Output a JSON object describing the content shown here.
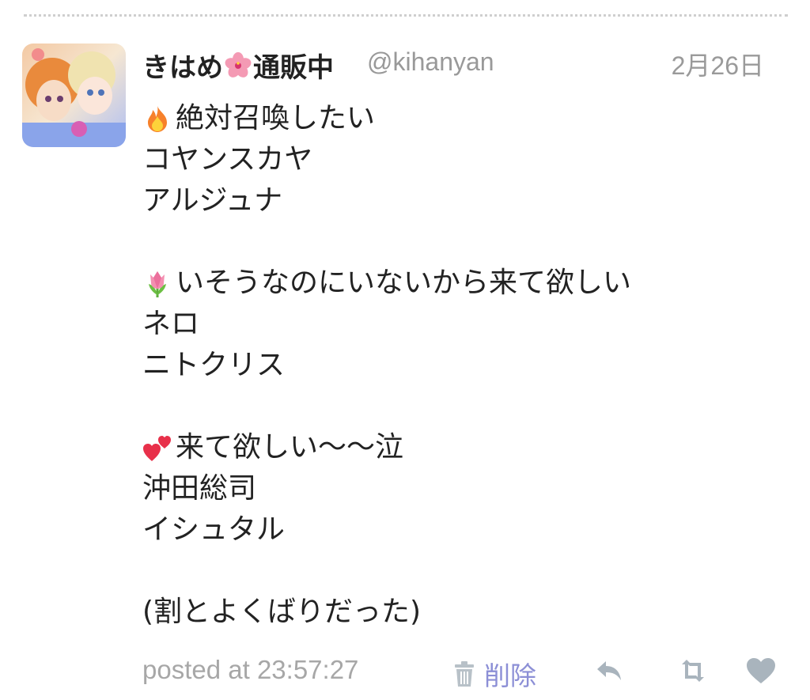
{
  "tweet": {
    "display_name": "きはめ",
    "display_name_suffix": "通販中",
    "handle": "@kihanyan",
    "date": "2月26日",
    "lines": [
      {
        "emoji": "fire-emoji",
        "text": "絶対召喚したい"
      },
      {
        "emoji": "",
        "text": "コヤンスカヤ"
      },
      {
        "emoji": "",
        "text": "アルジュナ"
      },
      {
        "emoji": "",
        "text": ""
      },
      {
        "emoji": "tulip-emoji",
        "text": "いそうなのにいないから来て欲しい"
      },
      {
        "emoji": "",
        "text": "ネロ"
      },
      {
        "emoji": "",
        "text": "ニトクリス"
      },
      {
        "emoji": "",
        "text": ""
      },
      {
        "emoji": "two-hearts-emoji",
        "text": "来て欲しい〜〜泣"
      },
      {
        "emoji": "",
        "text": "沖田総司"
      },
      {
        "emoji": "",
        "text": "イシュタル"
      },
      {
        "emoji": "",
        "text": ""
      },
      {
        "emoji": "",
        "text": "(割とよくばりだった)"
      }
    ],
    "posted_at": "posted at 23:57:27",
    "delete_label": "削除"
  },
  "colors": {
    "text": "#222222",
    "muted": "#9a9a9a",
    "delete_link": "#8c8fd6",
    "icon_gray": "#a9b4bd"
  },
  "icons": [
    "hibiscus-icon",
    "trash-icon",
    "reply-icon",
    "retweet-icon",
    "heart-icon"
  ]
}
